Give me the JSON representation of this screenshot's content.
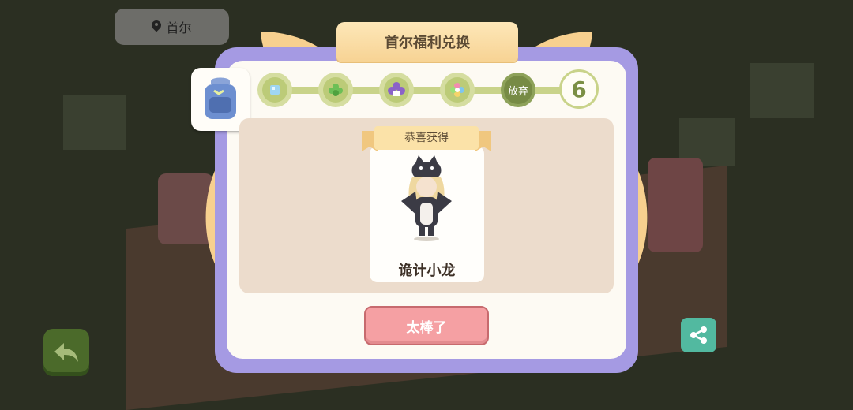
{
  "location": {
    "label": "首尔"
  },
  "dialog": {
    "title": "首尔福利兑换",
    "congrats_label": "恭喜获得",
    "item_name": "诡计小龙",
    "confirm_label": "太棒了"
  },
  "progress": {
    "steps": [
      {
        "icon": "ice-cube-icon"
      },
      {
        "icon": "green-flower-icon"
      },
      {
        "icon": "purple-flower-icon"
      },
      {
        "icon": "rainbow-flower-icon"
      }
    ],
    "give_up_label": "放弃",
    "remaining_count": "6"
  },
  "colors": {
    "panel_border": "#a59ae3",
    "track": "#c9d38a",
    "confirm_button": "#f5a0a3",
    "share_button": "#52b9a0"
  }
}
